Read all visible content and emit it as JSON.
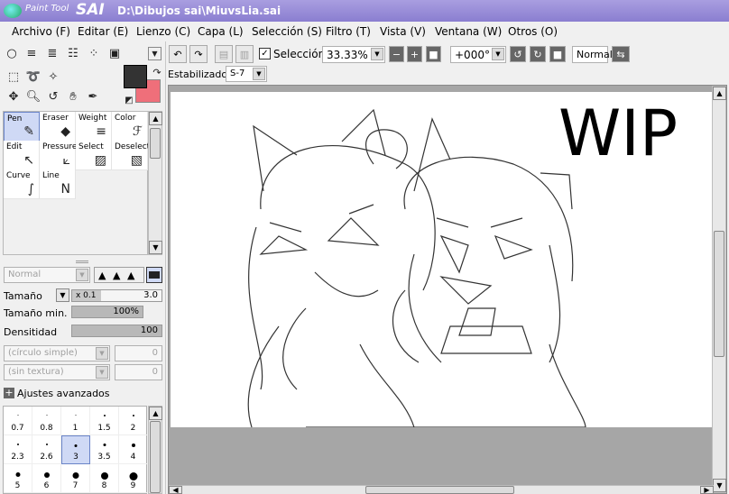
{
  "window": {
    "logo_top": "Paint Tool",
    "logo_main": "SAI",
    "title": "D:\\Dibujos sai\\MiuvsLia.sai"
  },
  "menu": [
    "Archivo (F)",
    "Editar (E)",
    "Lienzo (C)",
    "Capa (L)",
    "Selección (S)",
    "Filtro (T)",
    "Vista (V)",
    "Ventana (W)",
    "Otros (O)"
  ],
  "toolbar": {
    "selection_label": "Selección",
    "selection_checked": true,
    "zoom": "33.33%",
    "rotation": "+000°",
    "blend_mode": "Normal"
  },
  "stabilizer": {
    "label": "Estabilizador",
    "value": "S-7"
  },
  "tools": [
    {
      "label": "Pen",
      "icon": "pen-icon",
      "selected": true
    },
    {
      "label": "Eraser",
      "icon": "eraser-icon"
    },
    {
      "label": "Weight",
      "icon": "weight-icon"
    },
    {
      "label": "Color",
      "icon": "color-icon"
    },
    {
      "label": "Edit",
      "icon": "edit-icon"
    },
    {
      "label": "Pressure",
      "icon": "pressure-icon"
    },
    {
      "label": "Select",
      "icon": "select-icon"
    },
    {
      "label": "Deselect",
      "icon": "deselect-icon"
    },
    {
      "label": "Curve",
      "icon": "curve-icon"
    },
    {
      "label": "Line",
      "icon": "line-icon"
    }
  ],
  "brush": {
    "mode": "Normal",
    "size_label": "Tamaño",
    "size_multiplier": "x 0.1",
    "size_value": "3.0",
    "min_size_label": "Tamaño min.",
    "min_size_value": "100%",
    "density_label": "Densitidad",
    "density_value": "100",
    "shape": "(círculo simple)",
    "shape_value": "0",
    "texture": "(sin textura)",
    "texture_value": "0",
    "advanced_label": "Ajustes avanzados"
  },
  "brush_sizes": [
    [
      "0.7",
      "0.8",
      "1",
      "1.5",
      "2"
    ],
    [
      "2.3",
      "2.6",
      "3",
      "3.5",
      "4"
    ],
    [
      "5",
      "6",
      "7",
      "8",
      "9"
    ]
  ],
  "canvas_text": "WIP",
  "colors": {
    "primary": "#333333",
    "secondary": "#ef6f7a",
    "titlebar": "#8a7ed0"
  }
}
